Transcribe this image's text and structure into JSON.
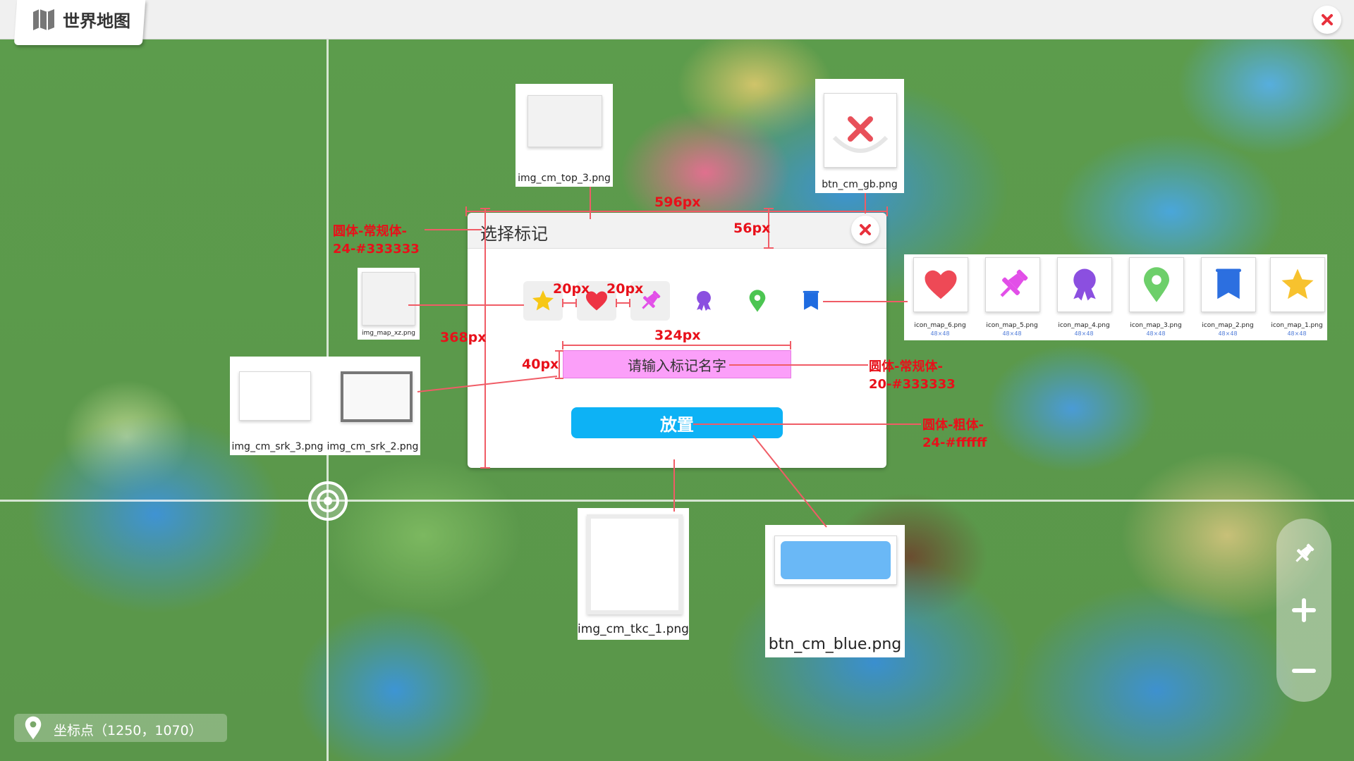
{
  "app": {
    "title": "世界地图",
    "close_icon": "close-icon"
  },
  "colors": {
    "accent_red": "#e8101a",
    "button_blue": "#0db2f5",
    "input_pink": "#fb9ff9",
    "text_dark": "#333333"
  },
  "dialog": {
    "title": "选择标记",
    "input_placeholder": "请输入标记名字",
    "place_button": "放置",
    "markers": [
      "star",
      "heart",
      "pushpin",
      "ribbon-badge",
      "location-pin",
      "banner"
    ]
  },
  "assets": {
    "img_cm_top_3": "img_cm_top_3.png",
    "btn_cm_gb": "btn_cm_gb.png",
    "img_map_xz": "img_map_xz.png",
    "img_cm_srk_3": "img_cm_srk_3.png",
    "img_cm_srk_2": "img_cm_srk_2.png",
    "img_cm_tkc_1": "img_cm_tkc_1.png",
    "btn_cm_blue": "btn_cm_blue.png"
  },
  "icon_strip": {
    "items": [
      {
        "name": "icon_map_6.png",
        "size": "48×48",
        "icon": "heart-icon"
      },
      {
        "name": "icon_map_5.png",
        "size": "48×48",
        "icon": "pushpin-icon"
      },
      {
        "name": "icon_map_4.png",
        "size": "48×48",
        "icon": "ribbon-badge-icon"
      },
      {
        "name": "icon_map_3.png",
        "size": "48×48",
        "icon": "location-pin-icon"
      },
      {
        "name": "icon_map_2.png",
        "size": "48×48",
        "icon": "banner-icon"
      },
      {
        "name": "icon_map_1.png",
        "size": "48×48",
        "icon": "star-icon"
      }
    ]
  },
  "annotations": {
    "width_596": "596px",
    "height_56": "56px",
    "height_368": "368px",
    "gap_20_a": "20px",
    "gap_20_b": "20px",
    "width_324": "324px",
    "height_40": "40px",
    "title_font_line1": "圆体-常规体-",
    "title_font_line2": "24-#333333",
    "input_font_line1": "圆体-常规体-",
    "input_font_line2": "20-#333333",
    "button_font_line1": "圆体-粗体-",
    "button_font_line2": "24-#ffffff"
  },
  "status": {
    "coord_label": "坐标点",
    "coord_value": "（1250，1070）"
  },
  "side_controls": [
    "pushpin-icon",
    "zoom-in-icon",
    "zoom-out-icon"
  ]
}
